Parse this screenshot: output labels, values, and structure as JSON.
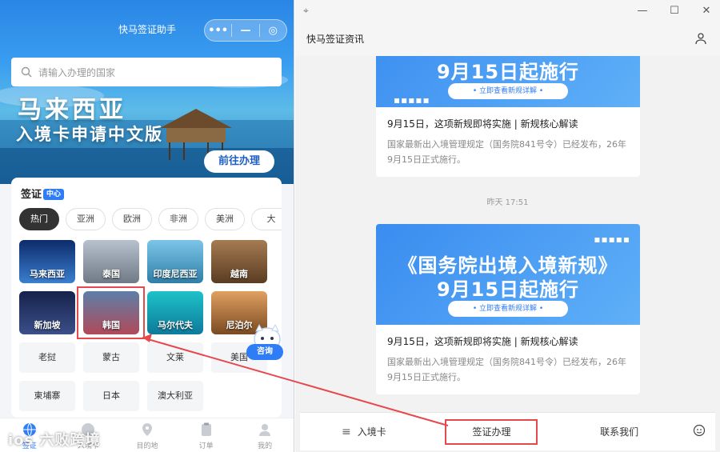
{
  "mini": {
    "title": "快马签证助手",
    "capsule": {
      "more": "•••",
      "minimize": "—",
      "close": "◎"
    },
    "search_placeholder": "请输入办理的国家",
    "banner": {
      "line1": "马来西亚",
      "line2": "入境卡申请中文版",
      "button": "前往办理"
    },
    "visa_center": {
      "title": "签证",
      "badge": "中心"
    },
    "chips": [
      "热门",
      "亚洲",
      "欧洲",
      "非洲",
      "美洲",
      "大"
    ],
    "countries_img": [
      {
        "name": "马来西亚",
        "color": "#1e5aa8"
      },
      {
        "name": "泰国",
        "color": "#8b96a3"
      },
      {
        "name": "印度尼西亚",
        "color": "#3f9ccf"
      },
      {
        "name": "越南",
        "color": "#7b5a3a"
      },
      {
        "name": "新加坡",
        "color": "#1a2c56"
      },
      {
        "name": "韩国",
        "color": "#3a5f8a"
      },
      {
        "name": "马尔代夫",
        "color": "#1ea8b8"
      },
      {
        "name": "尼泊尔",
        "color": "#b0692e"
      }
    ],
    "countries_plain": [
      "老挝",
      "蒙古",
      "文莱",
      "美国",
      "柬埔寨",
      "日本",
      "澳大利亚"
    ],
    "consult": "咨询",
    "tabs": [
      {
        "label": "签证",
        "icon": "globe-icon"
      },
      {
        "label": "入境卡",
        "icon": "card-icon"
      },
      {
        "label": "目的地",
        "icon": "location-icon"
      },
      {
        "label": "订单",
        "icon": "clipboard-icon"
      },
      {
        "label": "我的",
        "icon": "user-icon"
      }
    ],
    "watermark": "ios 六败跨境"
  },
  "win": {
    "pin": "⌖",
    "controls": {
      "min": "—",
      "max": "☐",
      "close": "✕"
    },
    "title": "快马签证资讯",
    "timestamp": "昨天 17:51",
    "messages": [
      {
        "dots": "▪▪▪▪▪",
        "img_line1": "",
        "img_line2": "9月15日起施行",
        "img_sub": "• 立即查看新规详解 •",
        "title": "9月15日，这项新规即将实施 | 新规核心解读",
        "desc": "国家最新出入境管理规定（国务院841号令）已经发布，26年9月15日正式施行。"
      },
      {
        "dots": "▪▪▪▪▪",
        "img_line1": "《国务院出境入境新规》",
        "img_line2": "9月15日起施行",
        "img_sub": "• 立即查看新规详解 •",
        "title": "9月15日，这项新规即将实施 | 新规核心解读",
        "desc": "国家最新出入境管理规定（国务院841号令）已经发布，26年9月15日正式施行。"
      }
    ],
    "menu": {
      "entry_card": "入境卡",
      "visa": "签证办理",
      "contact": "联系我们"
    }
  },
  "colors": {
    "accent": "#2f7df6",
    "highlight": "#e5484d"
  }
}
